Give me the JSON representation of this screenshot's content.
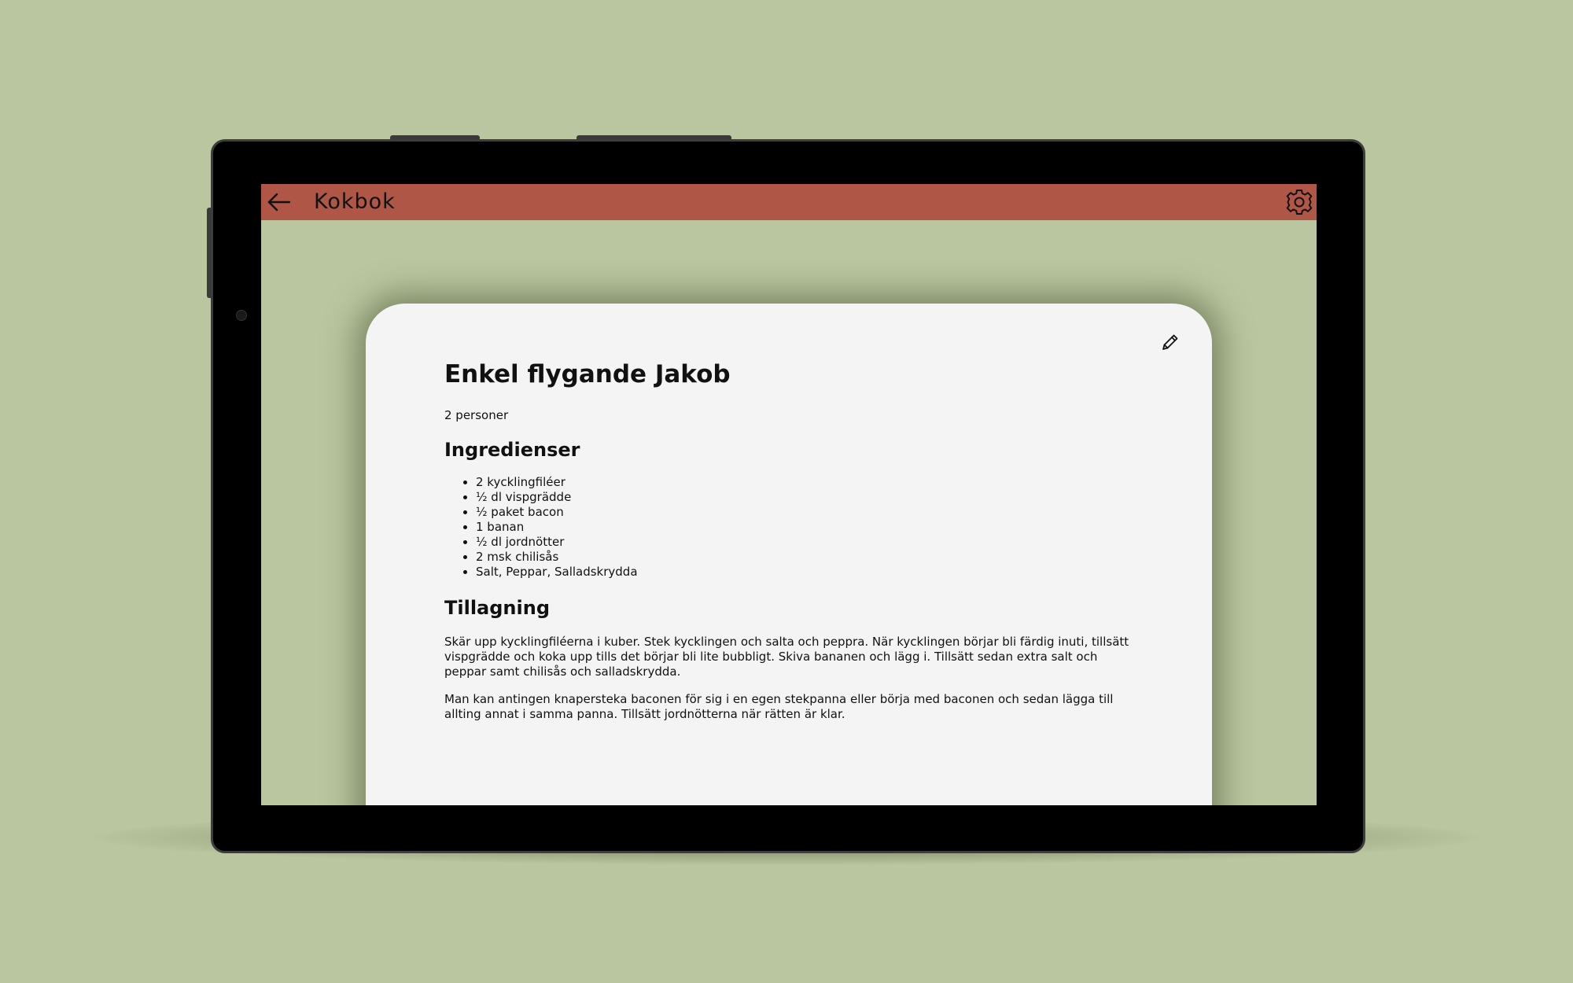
{
  "app_bar": {
    "title": "Kokbok",
    "background_color": "#b05646",
    "back_icon": "arrow-left-icon",
    "settings_icon": "gear-icon"
  },
  "recipe": {
    "title": "Enkel flygande Jakob",
    "servings": "2 personer",
    "edit_icon": "pencil-icon",
    "ingredients_heading": "Ingredienser",
    "ingredients": [
      "2 kycklingfiléer",
      "½ dl vispgrädde",
      "½ paket bacon",
      "1 banan",
      "½ dl jordnötter",
      "2 msk chilisås",
      "Salt, Peppar, Salladskrydda"
    ],
    "method_heading": "Tillagning",
    "steps": [
      "Skär upp kycklingfiléerna i kuber. Stek kycklingen och salta och peppra. När kycklingen börjar bli färdig inuti, tillsätt vispgrädde och koka upp tills det börjar bli lite bubbligt. Skiva bananen och lägg i. Tillsätt sedan extra salt och peppar samt chilisås och salladskrydda.",
      "Man kan antingen knapersteka baconen för sig i en egen stekpanna eller börja med baconen och sedan lägga till allting annat i samma panna. Tillsätt jordnötterna när rätten är klar."
    ]
  },
  "colors": {
    "background": "#bac69f",
    "card": "#f4f4f4",
    "device_frame": "#000000"
  }
}
